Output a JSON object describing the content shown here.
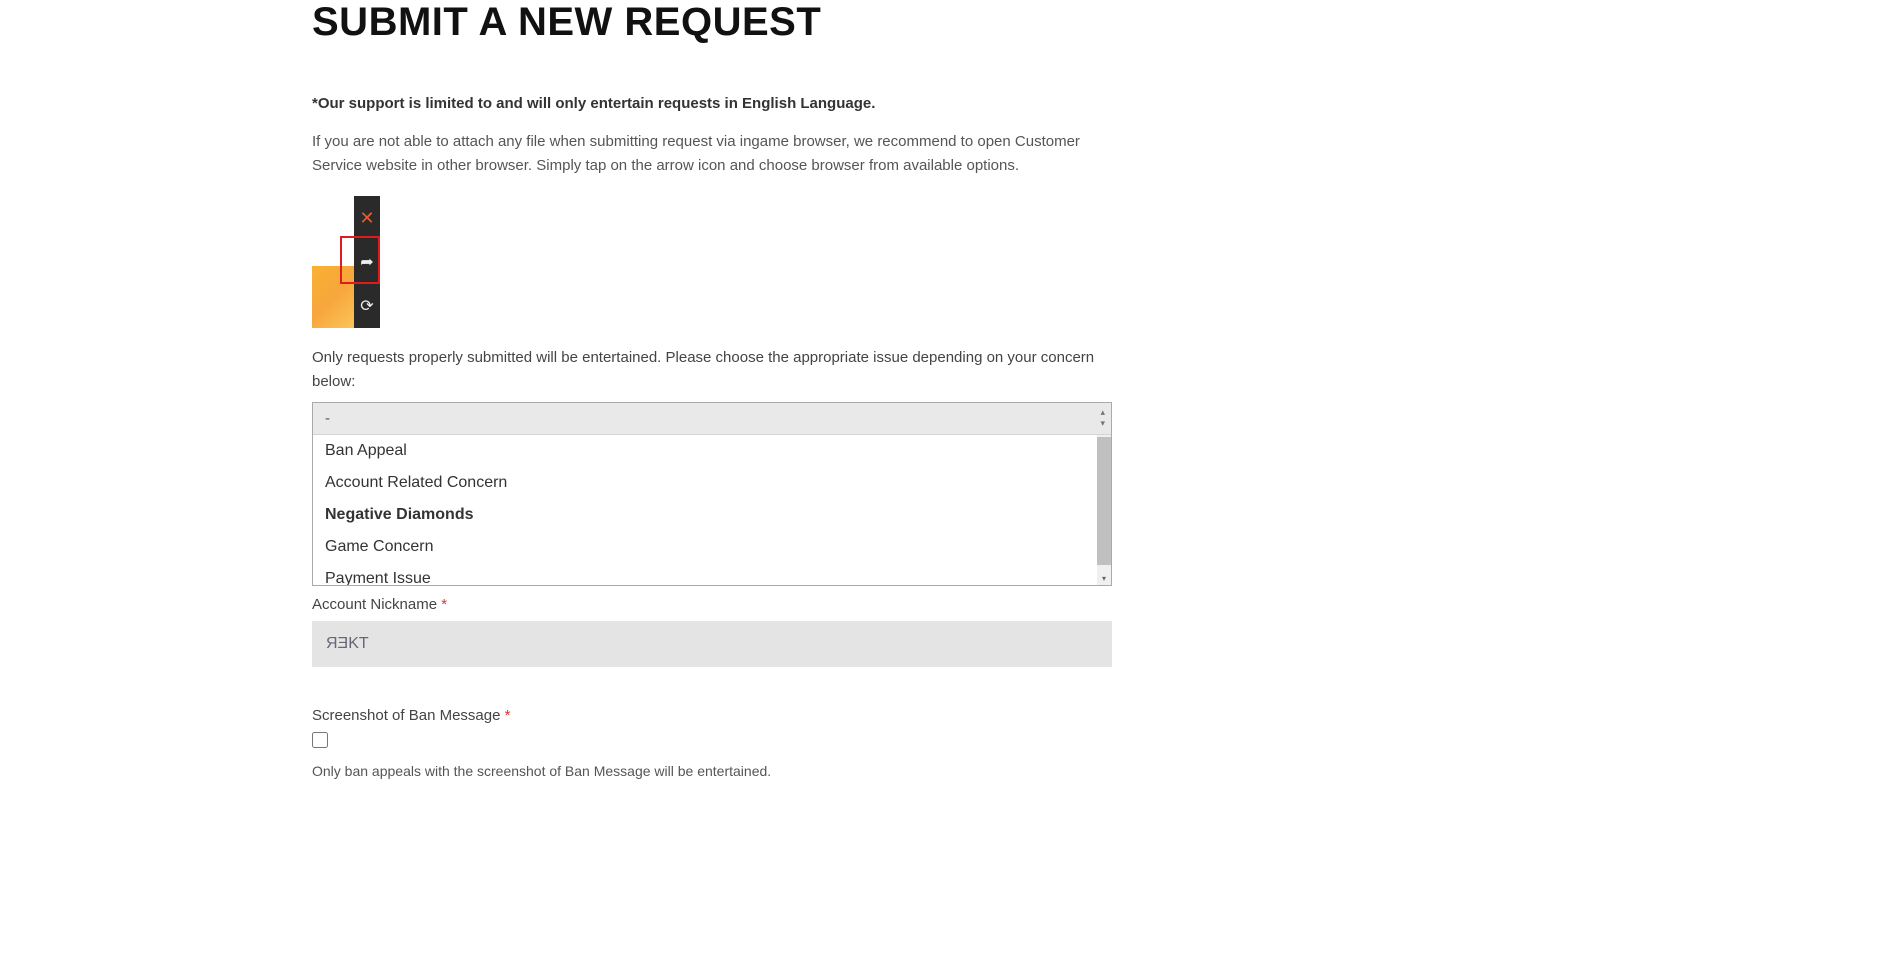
{
  "title": "SUBMIT A NEW REQUEST",
  "support_note": "*Our support is limited to and will only entertain requests in English Language.",
  "info_text": "If you are not able to attach any file when submitting request via ingame browser, we recommend to open Customer Service website in other browser. Simply tap on the arrow icon and choose browser from available options.",
  "instruction": "Only requests properly submitted will be entertained. Please choose the appropriate issue depending on your concern below:",
  "dropdown": {
    "placeholder": "-",
    "options": [
      "Ban Appeal",
      "Account Related Concern",
      "Negative Diamonds",
      "Game Concern",
      "Payment Issue"
    ],
    "selected_index": 2
  },
  "nickname": {
    "label": "Account Nickname",
    "required": "*",
    "value": "ЯƎKT"
  },
  "ban_screenshot": {
    "label": "Screenshot of Ban Message",
    "required": "*",
    "helper": "Only ban appeals with the screenshot of Ban Message will be entertained."
  }
}
